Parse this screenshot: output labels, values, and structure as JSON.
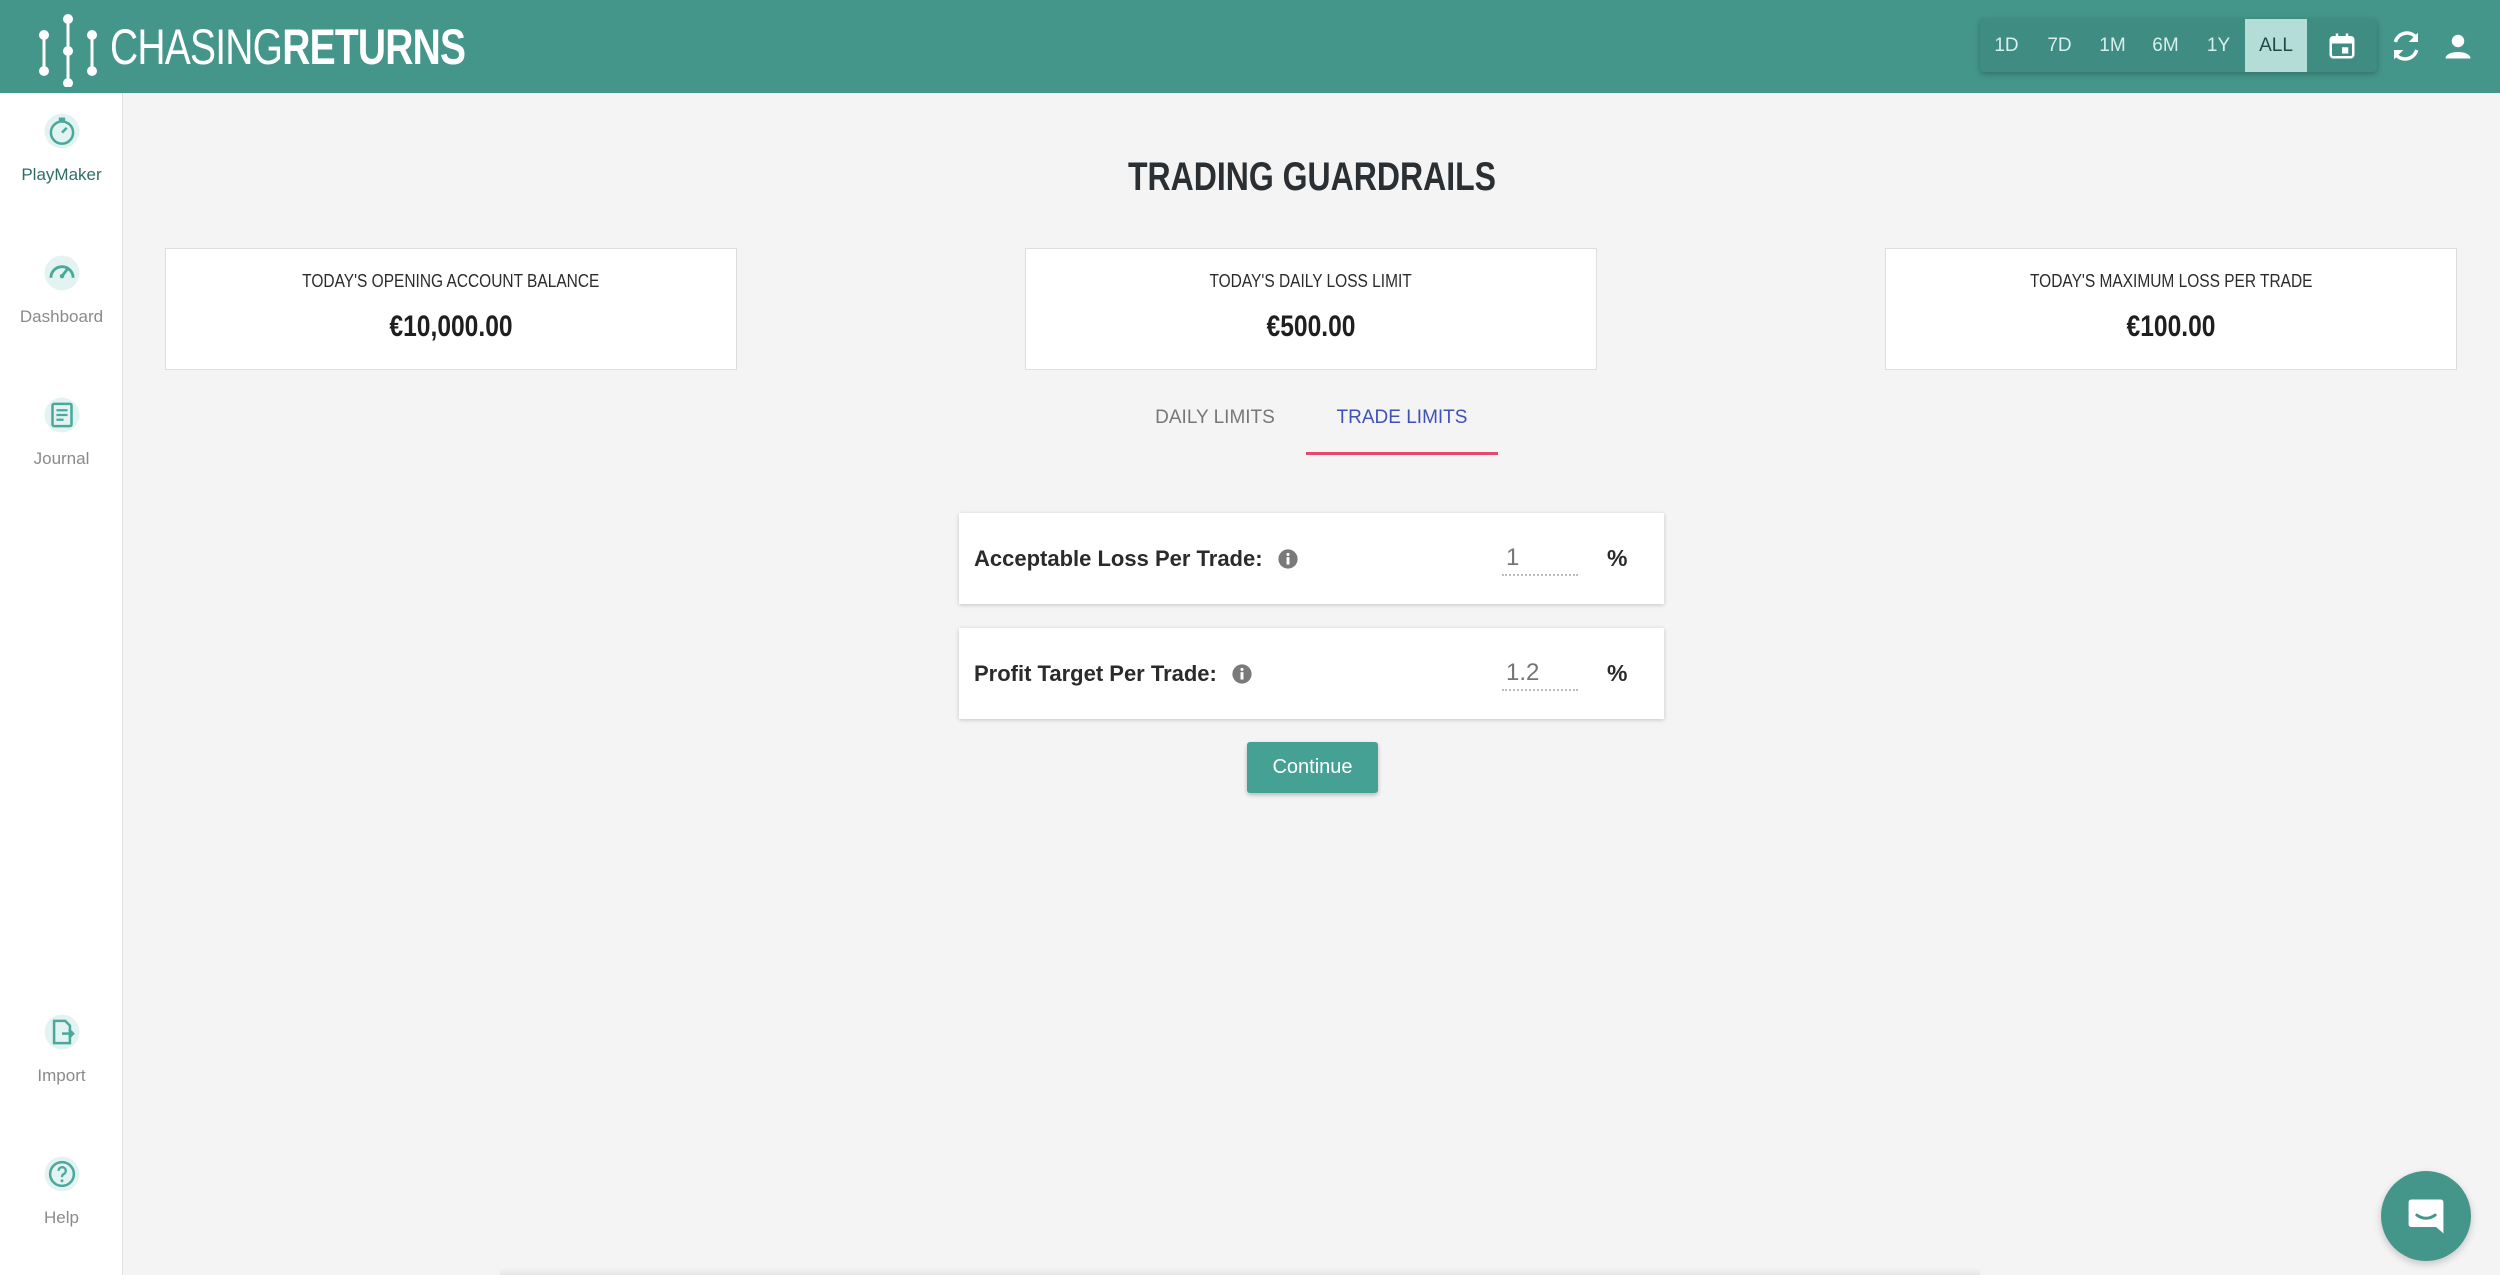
{
  "brand": {
    "name_thin": "CHASING",
    "name_bold": "RETURNS"
  },
  "header": {
    "ranges": [
      "1D",
      "7D",
      "1M",
      "6M",
      "1Y",
      "ALL"
    ],
    "active_range": "ALL"
  },
  "sidebar": {
    "items": [
      {
        "label": "PlayMaker",
        "icon": "stopwatch-icon",
        "active": true
      },
      {
        "label": "Dashboard",
        "icon": "speedometer-icon",
        "active": false
      },
      {
        "label": "Journal",
        "icon": "journal-icon",
        "active": false
      },
      {
        "label": "Import",
        "icon": "import-icon",
        "active": false
      },
      {
        "label": "Help",
        "icon": "help-icon",
        "active": false
      }
    ]
  },
  "main": {
    "title": "TRADING GUARDRAILS",
    "cards": [
      {
        "label": "TODAY'S OPENING ACCOUNT BALANCE",
        "value": "€10,000.00"
      },
      {
        "label": "TODAY'S DAILY LOSS LIMIT",
        "value": "€500.00"
      },
      {
        "label": "TODAY'S MAXIMUM LOSS PER TRADE",
        "value": "€100.00"
      }
    ],
    "tabs": [
      {
        "label": "DAILY LIMITS",
        "active": false
      },
      {
        "label": "TRADE LIMITS",
        "active": true
      }
    ],
    "fields": [
      {
        "label": "Acceptable Loss Per Trade:",
        "placeholder": "1",
        "unit": "%"
      },
      {
        "label": "Profit Target Per Trade:",
        "placeholder": "1.2",
        "unit": "%"
      }
    ],
    "continue_label": "Continue"
  },
  "colors": {
    "brand": "#44958a",
    "accent_tab": "#3f51b5",
    "tab_underline": "#e8476f",
    "button": "#44a193"
  }
}
